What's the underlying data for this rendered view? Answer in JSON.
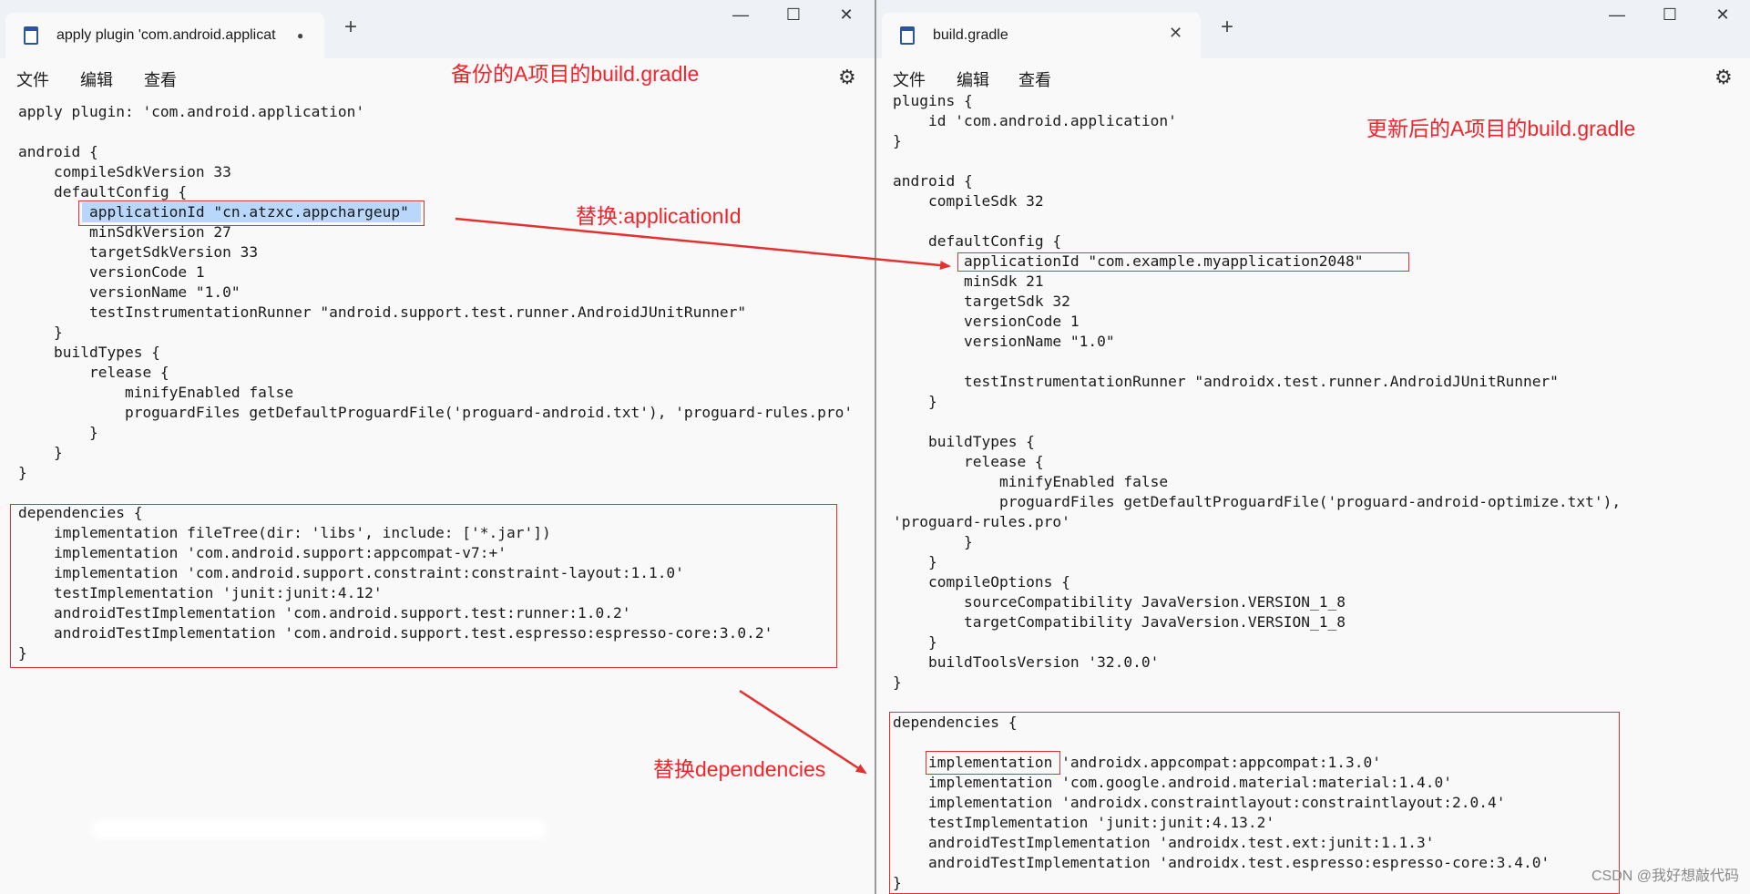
{
  "left": {
    "tab_title": "apply plugin 'com.android.applicat",
    "tab_modified": "●",
    "new_tab": "+",
    "menu": [
      "文件",
      "编辑",
      "查看"
    ],
    "annotation": "备份的A项目的build.gradle",
    "code_before": "apply plugin: 'com.android.application'\n\nandroid {\n    compileSdkVersion 33\n    defaultConfig {\n        ",
    "code_selected": "applicationId \"cn.atzxc.appchargeup\"",
    "code_after": "\n        minSdkVersion 27\n        targetSdkVersion 33\n        versionCode 1\n        versionName \"1.0\"\n        testInstrumentationRunner \"android.support.test.runner.AndroidJUnitRunner\"\n    }\n    buildTypes {\n        release {\n            minifyEnabled false\n            proguardFiles getDefaultProguardFile('proguard-android.txt'), 'proguard-rules.pro'\n        }\n    }\n}\n\ndependencies {\n    implementation fileTree(dir: 'libs', include: ['*.jar'])\n    implementation 'com.android.support:appcompat-v7:+'\n    implementation 'com.android.support.constraint:constraint-layout:1.1.0'\n    testImplementation 'junit:junit:4.12'\n    androidTestImplementation 'com.android.support.test:runner:1.0.2'\n    androidTestImplementation 'com.android.support.test.espresso:espresso-core:3.0.2'\n}"
  },
  "right": {
    "tab_title": "build.gradle",
    "tab_close": "✕",
    "new_tab": "+",
    "menu": [
      "文件",
      "编辑",
      "查看"
    ],
    "annotation": "更新后的A项目的build.gradle",
    "code": "plugins {\n    id 'com.android.application'\n}\n\nandroid {\n    compileSdk 32\n\n    defaultConfig {\n        applicationId \"com.example.myapplication2048\"\n        minSdk 21\n        targetSdk 32\n        versionCode 1\n        versionName \"1.0\"\n\n        testInstrumentationRunner \"androidx.test.runner.AndroidJUnitRunner\"\n    }\n\n    buildTypes {\n        release {\n            minifyEnabled false\n            proguardFiles getDefaultProguardFile('proguard-android-optimize.txt'),\n'proguard-rules.pro'\n        }\n    }\n    compileOptions {\n        sourceCompatibility JavaVersion.VERSION_1_8\n        targetCompatibility JavaVersion.VERSION_1_8\n    }\n    buildToolsVersion '32.0.0'\n}\n\ndependencies {\n\n    implementation 'androidx.appcompat:appcompat:1.3.0'\n    implementation 'com.google.android.material:material:1.4.0'\n    implementation 'androidx.constraintlayout:constraintlayout:2.0.4'\n    testImplementation 'junit:junit:4.13.2'\n    androidTestImplementation 'androidx.test.ext:junit:1.1.3'\n    androidTestImplementation 'androidx.test.espresso:espresso-core:3.4.0'\n}"
  },
  "window_controls": {
    "minimize": "—",
    "maximize": "☐",
    "close": "✕"
  },
  "settings_icon": "⚙",
  "annotations": {
    "replace_app_id": "替换:applicationId",
    "replace_deps": "替换dependencies"
  },
  "watermark": "CSDN @我好想敲代码",
  "colors": {
    "annotation_red": "#f2232a",
    "selection": "#b8d7fb",
    "editor_bg": "#f9f9f9"
  }
}
